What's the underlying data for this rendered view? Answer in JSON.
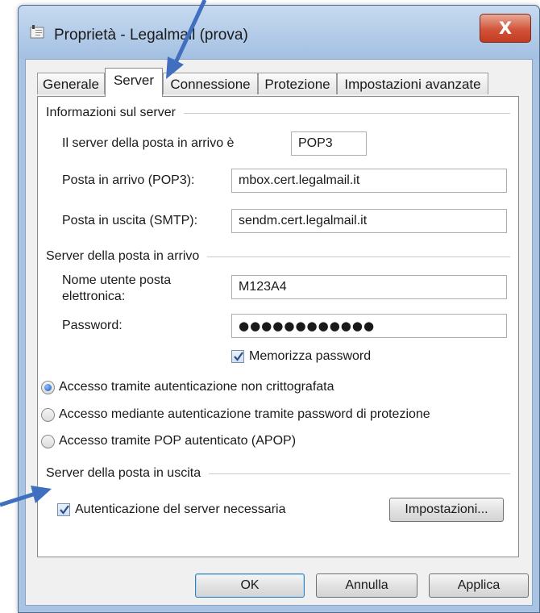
{
  "window": {
    "title": "Proprietà - Legalmail (prova)",
    "close_glyph": "X"
  },
  "tabs": [
    {
      "label": "Generale",
      "active": false
    },
    {
      "label": "Server",
      "active": true
    },
    {
      "label": "Connessione",
      "active": false
    },
    {
      "label": "Protezione",
      "active": false
    },
    {
      "label": "Impostazioni avanzate",
      "active": false
    }
  ],
  "server_info": {
    "group_title": "Informazioni sul server",
    "incoming_type_label": "Il server della posta in arrivo è",
    "incoming_type_value": "POP3",
    "incoming_label": "Posta in arrivo (POP3):",
    "incoming_value": "mbox.cert.legalmail.it",
    "outgoing_label": "Posta in uscita (SMTP):",
    "outgoing_value": "sendm.cert.legalmail.it"
  },
  "incoming_server": {
    "group_title": "Server della posta in arrivo",
    "username_label_line1": "Nome utente posta",
    "username_label_line2": "elettronica:",
    "username_value": "M123A4",
    "password_label": "Password:",
    "password_value": "●●●●●●●●●●●●",
    "remember_label": "Memorizza password",
    "remember_checked": true
  },
  "auth_options": [
    {
      "label": "Accesso tramite autenticazione non crittografata",
      "selected": true
    },
    {
      "label": "Accesso mediante autenticazione tramite password di protezione",
      "selected": false
    },
    {
      "label": "Accesso tramite POP autenticato (APOP)",
      "selected": false
    }
  ],
  "outgoing_server": {
    "group_title": "Server della posta in uscita",
    "auth_required_label": "Autenticazione del server necessaria",
    "auth_required_checked": true,
    "settings_button": "Impostazioni..."
  },
  "footer": {
    "ok": "OK",
    "cancel": "Annulla",
    "apply": "Applica"
  },
  "colors": {
    "annotation_arrow": "#3f6fbe"
  }
}
